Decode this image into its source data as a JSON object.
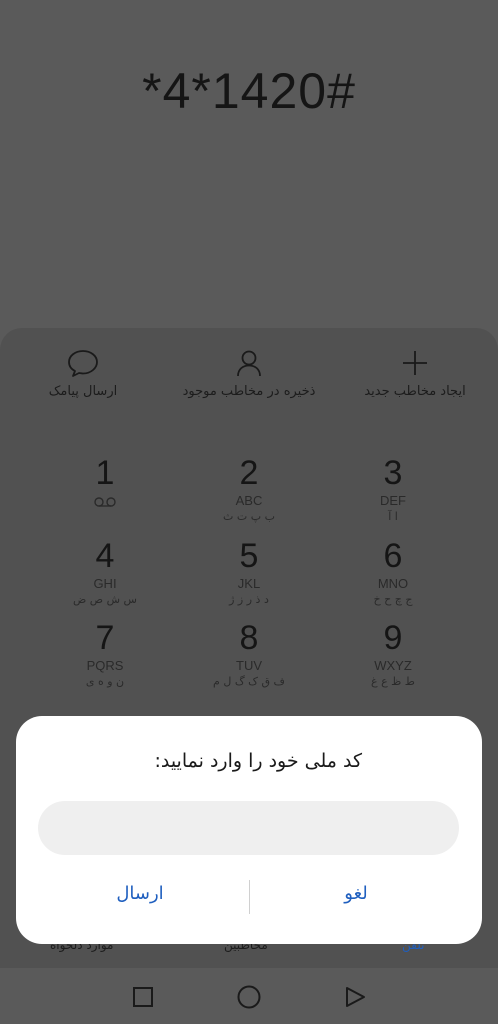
{
  "dialer": {
    "number": "*4*1420#"
  },
  "actions": [
    {
      "label": "ارسال پیامک",
      "icon": "message-icon"
    },
    {
      "label": "ذخیره در مخاطب موجود",
      "icon": "contact-icon"
    },
    {
      "label": "ایجاد مخاطب جدید",
      "icon": "plus-icon"
    }
  ],
  "keypad": [
    {
      "num": "1",
      "lat": "",
      "fa": "",
      "voicemail": true
    },
    {
      "num": "2",
      "lat": "ABC",
      "fa": "ب پ ت ث"
    },
    {
      "num": "3",
      "lat": "DEF",
      "fa": "ا آ"
    },
    {
      "num": "4",
      "lat": "GHI",
      "fa": "س ش ص ض"
    },
    {
      "num": "5",
      "lat": "JKL",
      "fa": "د ذ ر ز ژ"
    },
    {
      "num": "6",
      "lat": "MNO",
      "fa": "ج چ ح خ"
    },
    {
      "num": "7",
      "lat": "PQRS",
      "fa": "ن و ه ی"
    },
    {
      "num": "8",
      "lat": "TUV",
      "fa": "ف ق ک گ ل م"
    },
    {
      "num": "9",
      "lat": "WXYZ",
      "fa": "ط ظ ع غ"
    }
  ],
  "tabs": {
    "left": "موارد دلخواه",
    "center": "مخاطبین",
    "right": "تلفن"
  },
  "dialog": {
    "title": "کد ملی خود را وارد نمایید:",
    "input_value": "",
    "send_label": "ارسال",
    "cancel_label": "لغو",
    "accent": "#1f5fbf"
  }
}
